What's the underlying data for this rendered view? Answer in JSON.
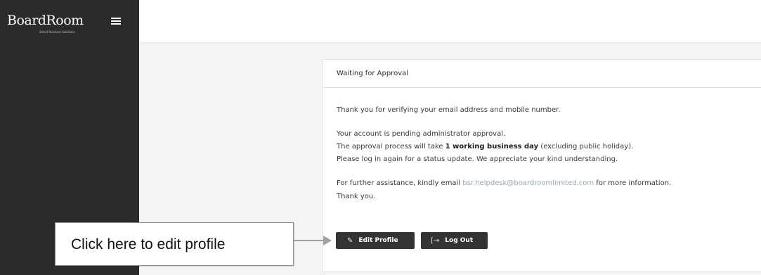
{
  "brand": {
    "logo_text": "BoardRoom",
    "tagline": "Smart Business Solutions"
  },
  "icons": {
    "menu": "hamburger-menu-icon",
    "edit": "edit-square-icon",
    "logout": "logout-arrow-icon"
  },
  "card": {
    "title": "Waiting for Approval",
    "line1": "Thank you for verifying your email address and mobile number.",
    "line2": "Your account is pending administrator approval.",
    "line3_prefix": "The approval process will take ",
    "line3_bold": "1 working business day",
    "line3_suffix": " (excluding public holiday).",
    "line4": "Please log in again for a status update. We appreciate your kind understanding.",
    "line5_prefix": "For further assistance, kindly email ",
    "line5_email": "bsr.helpdesk@boardroomlimited.com",
    "line5_suffix": " for more information.",
    "line6": "Thank you."
  },
  "buttons": {
    "edit_profile": "Edit Profile",
    "log_out": "Log Out"
  },
  "callout": {
    "text": "Click here to edit profile"
  },
  "colors": {
    "sidebar": "#2b2b2b",
    "button": "#333333",
    "content_bg": "#f4f4f4"
  }
}
